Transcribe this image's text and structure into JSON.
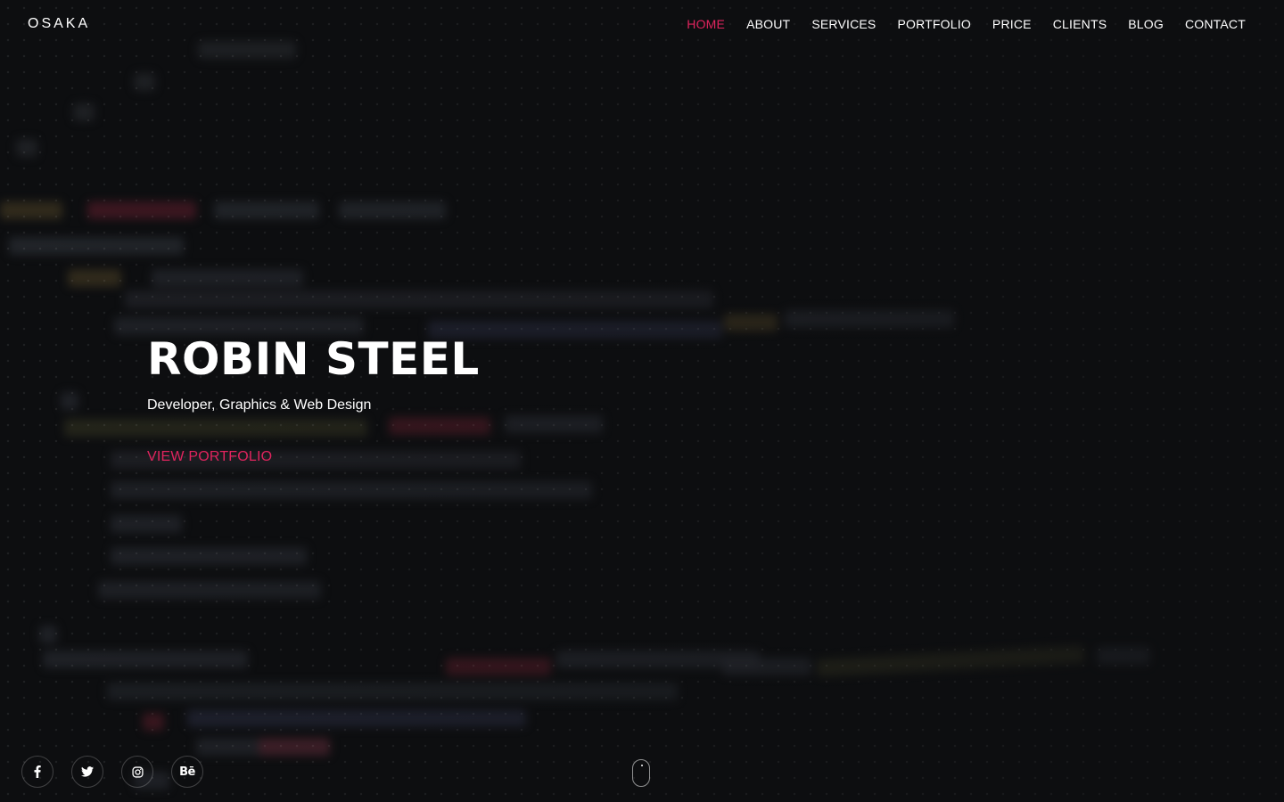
{
  "header": {
    "logo": "OSAKA",
    "nav": [
      {
        "label": "HOME",
        "active": true
      },
      {
        "label": "ABOUT",
        "active": false
      },
      {
        "label": "SERVICES",
        "active": false
      },
      {
        "label": "PORTFOLIO",
        "active": false
      },
      {
        "label": "PRICE",
        "active": false
      },
      {
        "label": "CLIENTS",
        "active": false
      },
      {
        "label": "BLOG",
        "active": false
      },
      {
        "label": "CONTACT",
        "active": false
      }
    ]
  },
  "hero": {
    "name": "ROBIN STEEL",
    "role": "Developer, Graphics & Web Design",
    "cta": "VIEW PORTFOLIO"
  },
  "social": [
    {
      "icon": "facebook-icon"
    },
    {
      "icon": "twitter-icon"
    },
    {
      "icon": "instagram-icon"
    },
    {
      "icon": "behance-icon",
      "text": "Bē"
    }
  ],
  "colors": {
    "accent": "#e0245e",
    "background": "#0d0e10",
    "text": "#ffffff"
  }
}
